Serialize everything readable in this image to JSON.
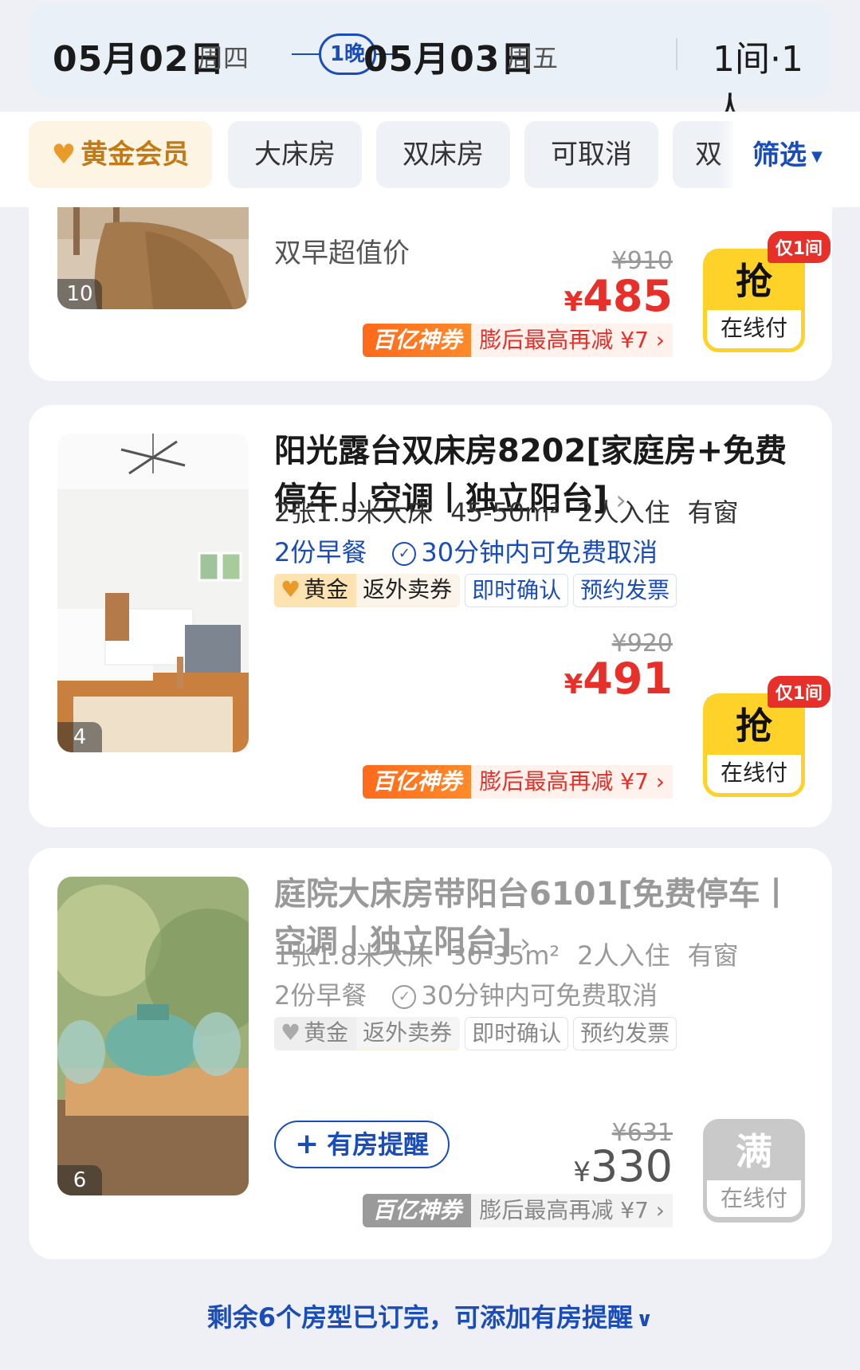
{
  "header": {
    "checkin_date": "05月02日",
    "checkin_weekday": "周四",
    "nights": "1晚",
    "checkout_date": "05月03日",
    "checkout_weekday": "周五",
    "rooms_guests": "1间·1人"
  },
  "filters": {
    "chips": [
      "黄金会员",
      "大床房",
      "双床房",
      "可取消",
      "双"
    ],
    "filter_label": "筛选"
  },
  "rooms": [
    {
      "photo_count": "10",
      "plan_name": "双早超值价",
      "old_price": "¥910",
      "currency": "¥",
      "price": "485",
      "promo_badge": "百亿神券",
      "promo_text": "膨后最高再减 ¥7 ›",
      "grab_label": "抢",
      "pay_label": "在线付",
      "only_left": "仅1间"
    },
    {
      "photo_count": "4",
      "title": "阳光露台双床房8202[家庭房+免费停车丨空调丨独立阳台]",
      "bed": "2张1.5米大床",
      "area": "45-50m²",
      "occupancy": "2人入住",
      "window": "有窗",
      "breakfast": "2份早餐",
      "cancel": "30分钟内可免费取消",
      "tag_gold": "黄金",
      "tag_gold_extra": "返外卖券",
      "tag_confirm": "即时确认",
      "tag_invoice": "预约发票",
      "old_price": "¥920",
      "currency": "¥",
      "price": "491",
      "promo_badge": "百亿神券",
      "promo_text": "膨后最高再减 ¥7 ›",
      "grab_label": "抢",
      "pay_label": "在线付",
      "only_left": "仅1间"
    },
    {
      "photo_count": "6",
      "title": "庭院大床房带阳台6101[免费停车丨空调丨独立阳台]",
      "bed": "1张1.8米大床",
      "area": "30-35m²",
      "occupancy": "2人入住",
      "window": "有窗",
      "breakfast": "2份早餐",
      "cancel": "30分钟内可免费取消",
      "tag_gold": "黄金",
      "tag_gold_extra": "返外卖券",
      "tag_confirm": "即时确认",
      "tag_invoice": "预约发票",
      "remind_label": "有房提醒",
      "old_price": "¥631",
      "currency": "¥",
      "price": "330",
      "promo_badge": "百亿神券",
      "promo_text": "膨后最高再减 ¥7 ›",
      "full_label": "满",
      "pay_label": "在线付"
    }
  ],
  "footer": {
    "text": "剩余6个房型已订完，可添加有房提醒"
  },
  "colors": {
    "accent_blue": "#1a4db8",
    "price_red": "#e8302a",
    "grab_yellow": "#ffd22a",
    "gold": "#e99a28"
  }
}
